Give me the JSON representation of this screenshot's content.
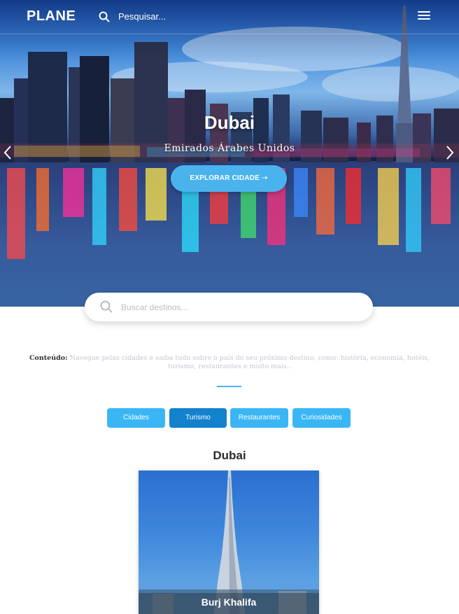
{
  "nav": {
    "logo": "PLANE",
    "search_label": "Pesquisar..."
  },
  "hero": {
    "title": "Dubai",
    "subtitle": "Emirados Árabes Unidos",
    "button_label": "EXPLORAR CIDADE ➝"
  },
  "search": {
    "placeholder": "Buscar destinos..."
  },
  "content": {
    "label": "Conteúdo:",
    "text": "Navegue pelas cidades e saiba tudo sobre o país do seu próximo destino, como: história, economia, hotéis, turismo, restaurantes e muito mais.."
  },
  "tabs": [
    {
      "label": "Cidades",
      "active": false
    },
    {
      "label": "Turismo",
      "active": true
    },
    {
      "label": "Restaurantes",
      "active": false
    },
    {
      "label": "Curiosidades",
      "active": false
    }
  ],
  "section": {
    "title": "Dubai"
  },
  "card": {
    "caption": "Burj Khalifa"
  },
  "colors": {
    "accent": "#4ab3ee",
    "tab": "#3bb6f5",
    "tab_active": "#1481cc"
  },
  "icons": [
    "search-icon",
    "menu-icon",
    "chevron-left-icon",
    "chevron-right-icon"
  ]
}
